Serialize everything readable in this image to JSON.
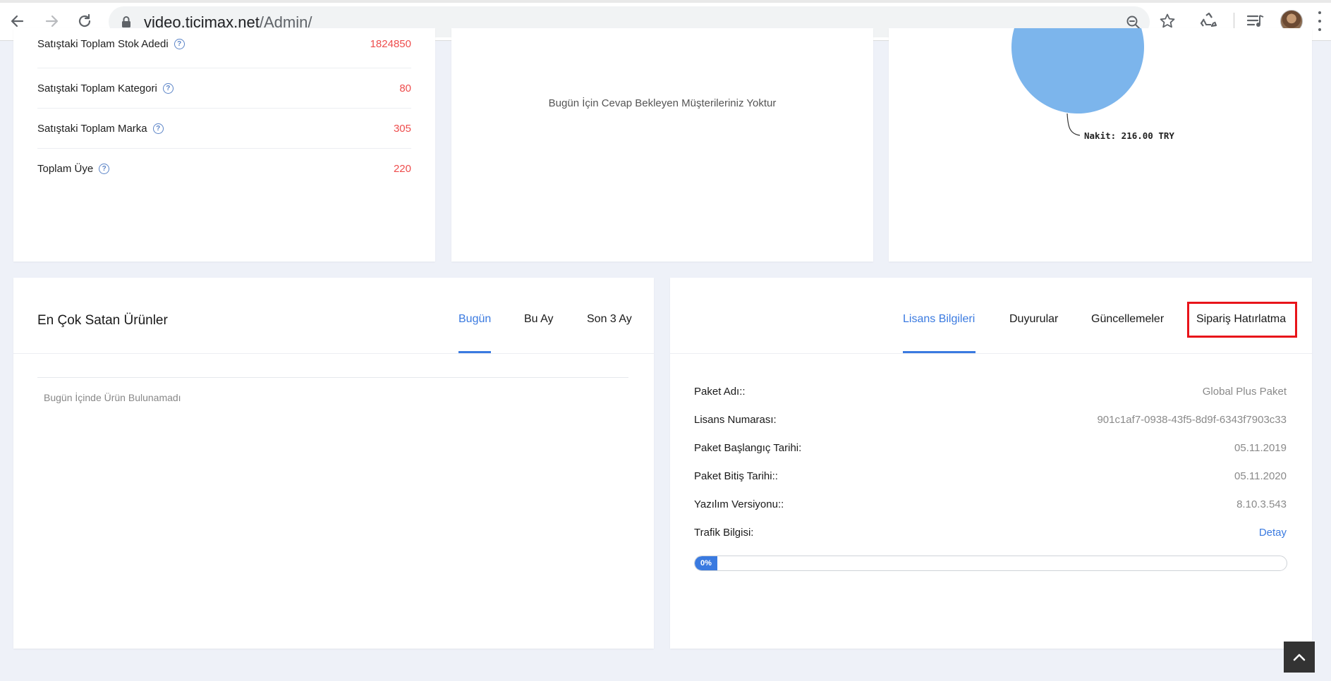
{
  "browser": {
    "url_host": "video.ticimax.net",
    "url_path": "/Admin/"
  },
  "stats": {
    "rows": [
      {
        "label": "Satıştaki Toplam Stok Adedi",
        "value": "1824850"
      },
      {
        "label": "Satıştaki Toplam Kategori",
        "value": "80"
      },
      {
        "label": "Satıştaki Toplam Marka",
        "value": "305"
      },
      {
        "label": "Toplam Üye",
        "value": "220"
      }
    ],
    "help_glyph": "?"
  },
  "messages": {
    "empty_text": "Bugün İçin Cevap Bekleyen Müşterileriniz Yoktur"
  },
  "chart_data": {
    "type": "pie",
    "categories": [
      "Nakit"
    ],
    "values": [
      216.0
    ],
    "labels": [
      "Nakit: 216.00 TRY"
    ],
    "colors": [
      "#7cb5ec"
    ]
  },
  "best_sellers": {
    "title": "En Çok Satan Ürünler",
    "tabs": [
      "Bugün",
      "Bu Ay",
      "Son 3 Ay"
    ],
    "active_tab": 0,
    "empty_text": "Bugün İçinde Ürün Bulunamadı"
  },
  "license": {
    "tabs": [
      "Lisans Bilgileri",
      "Duyurular",
      "Güncellemeler",
      "Sipariş Hatırlatma"
    ],
    "active_tab": 0,
    "highlighted_tab": 3,
    "rows": [
      {
        "key": "Paket Adı::",
        "value": "Global Plus Paket"
      },
      {
        "key": "Lisans Numarası:",
        "value": "901c1af7-0938-43f5-8d9f-6343f7903c33"
      },
      {
        "key": "Paket Başlangıç Tarihi:",
        "value": "05.11.2019"
      },
      {
        "key": "Paket Bitiş Tarihi::",
        "value": "05.11.2020"
      },
      {
        "key": "Yazılım Versiyonu::",
        "value": "8.10.3.543"
      },
      {
        "key": "Trafik Bilgisi:",
        "value": "Detay"
      }
    ],
    "traffic_progress": {
      "percent": 0,
      "label": "0%"
    }
  },
  "colors": {
    "accent": "#3a7ae0",
    "stat_value": "#ee4d4d",
    "highlight_box": "#e8141a",
    "page_bg": "#eef1f8"
  },
  "icons": {
    "back": "arrow-left-icon",
    "forward": "arrow-right-icon",
    "reload": "reload-icon",
    "lock": "lock-icon",
    "zoom": "zoom-icon",
    "bookmark": "star-icon",
    "extension": "recycle-icon",
    "media": "playlist-icon",
    "menu": "kebab-menu-icon",
    "scroll_top": "chevron-up-icon"
  }
}
